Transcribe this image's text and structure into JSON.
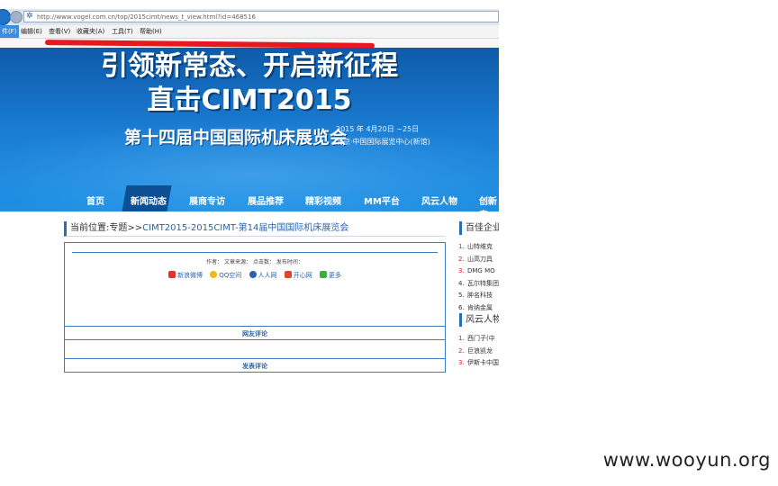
{
  "browser": {
    "url": "http://www.vogel.com.cn/top/2015cimt/news_t_view.html?id=468516",
    "menu": [
      "件(F)",
      "编辑(E)",
      "查看(V)",
      "收藏夹(A)",
      "工具(T)",
      "帮助(H)"
    ]
  },
  "banner": {
    "slogan_line1": "引领新常态、开启新征程",
    "slogan_line2": "直击CIMT2015",
    "expo_title": "第十四届中国国际机床展览会",
    "expo_date": "2015 年 4月20日 ~25日",
    "expo_place": "北京·中国国际展览中心(新馆)"
  },
  "nav": {
    "items": [
      "首页",
      "新闻动态",
      "展商专访",
      "展品推荐",
      "精彩视频",
      "MM平台",
      "风云人物",
      "创新产"
    ],
    "active": "新闻动态"
  },
  "breadcrumb": {
    "prefix": "当前位置:专题>>",
    "link": "CIMT2015-2015CIMT-第14届中国国际机床展览会"
  },
  "article": {
    "meta": "作者：   文章来源：   点击数：   发布时间：",
    "share": [
      "新浪微博",
      "QQ空间",
      "人人网",
      "开心网",
      "更多"
    ],
    "section_comments": "网友评论",
    "section_post": "发表评论"
  },
  "sidebar": {
    "head1": "百佳企业",
    "list1": [
      {
        "num": "1.",
        "text": "山特维克",
        "red": true
      },
      {
        "num": "2.",
        "text": "山高刀具",
        "red": true
      },
      {
        "num": "3.",
        "text": "DMG MO",
        "red": true
      },
      {
        "num": "4.",
        "text": "瓦尔特集团",
        "red": false
      },
      {
        "num": "5.",
        "text": "肿名科技",
        "red": false
      },
      {
        "num": "6.",
        "text": "肯纳金属",
        "red": false
      }
    ],
    "head2": "风云人物",
    "list2": [
      {
        "num": "1.",
        "text": "西门子(中",
        "red": true
      },
      {
        "num": "2.",
        "text": "巨浪凯龙",
        "red": true
      },
      {
        "num": "3.",
        "text": "伊斯卡中国",
        "red": true
      }
    ]
  },
  "watermark": "www.wooyun.org",
  "colors": {
    "banner": "#1a7fd6",
    "accent": "#2b63ad",
    "redaction": "#e8191e",
    "rank_red": "#d9211e"
  }
}
